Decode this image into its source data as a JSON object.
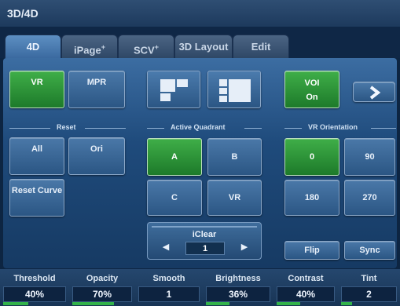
{
  "window": {
    "title": "3D/4D"
  },
  "tabs": [
    {
      "label": "4D",
      "active": true
    },
    {
      "label": "iPage",
      "sup": "+"
    },
    {
      "label": "SCV",
      "sup": "+"
    },
    {
      "label": "3D Layout"
    },
    {
      "label": "Edit"
    }
  ],
  "mode": {
    "vr": "VR",
    "mpr": "MPR"
  },
  "voi": {
    "line1": "VOI",
    "line2": "On"
  },
  "groups": {
    "reset": "Reset",
    "active_quadrant": "Active Quadrant",
    "vr_orientation": "VR Orientation"
  },
  "reset": {
    "all": "All",
    "ori": "Ori",
    "reset_curve": "Reset Curve"
  },
  "quadrant": {
    "a": "A",
    "b": "B",
    "c": "C",
    "vr": "VR"
  },
  "orientation": {
    "o0": "0",
    "o90": "90",
    "o180": "180",
    "o270": "270",
    "flip": "Flip",
    "sync": "Sync"
  },
  "iclear": {
    "label": "iClear",
    "value": "1"
  },
  "knobs": [
    {
      "name": "Threshold",
      "value": "40%",
      "level": 0.4
    },
    {
      "name": "Opacity",
      "value": "70%",
      "level": 0.7
    },
    {
      "name": "Smooth",
      "value": "1",
      "level": 0.0
    },
    {
      "name": "Brightness",
      "value": "36%",
      "level": 0.36
    },
    {
      "name": "Contrast",
      "value": "40%",
      "level": 0.4
    },
    {
      "name": "Tint",
      "value": "2",
      "level": 0.2
    }
  ],
  "colors": {
    "active_green": "#2e9c3a",
    "button_blue": "#3a6796",
    "background": "#0d2542"
  },
  "icons": {
    "next": "chevron-right-icon",
    "layout_quad": "quad-layout-icon",
    "layout_split": "split-layout-icon",
    "iclear_left": "arrow-left-icon",
    "iclear_right": "arrow-right-icon"
  }
}
